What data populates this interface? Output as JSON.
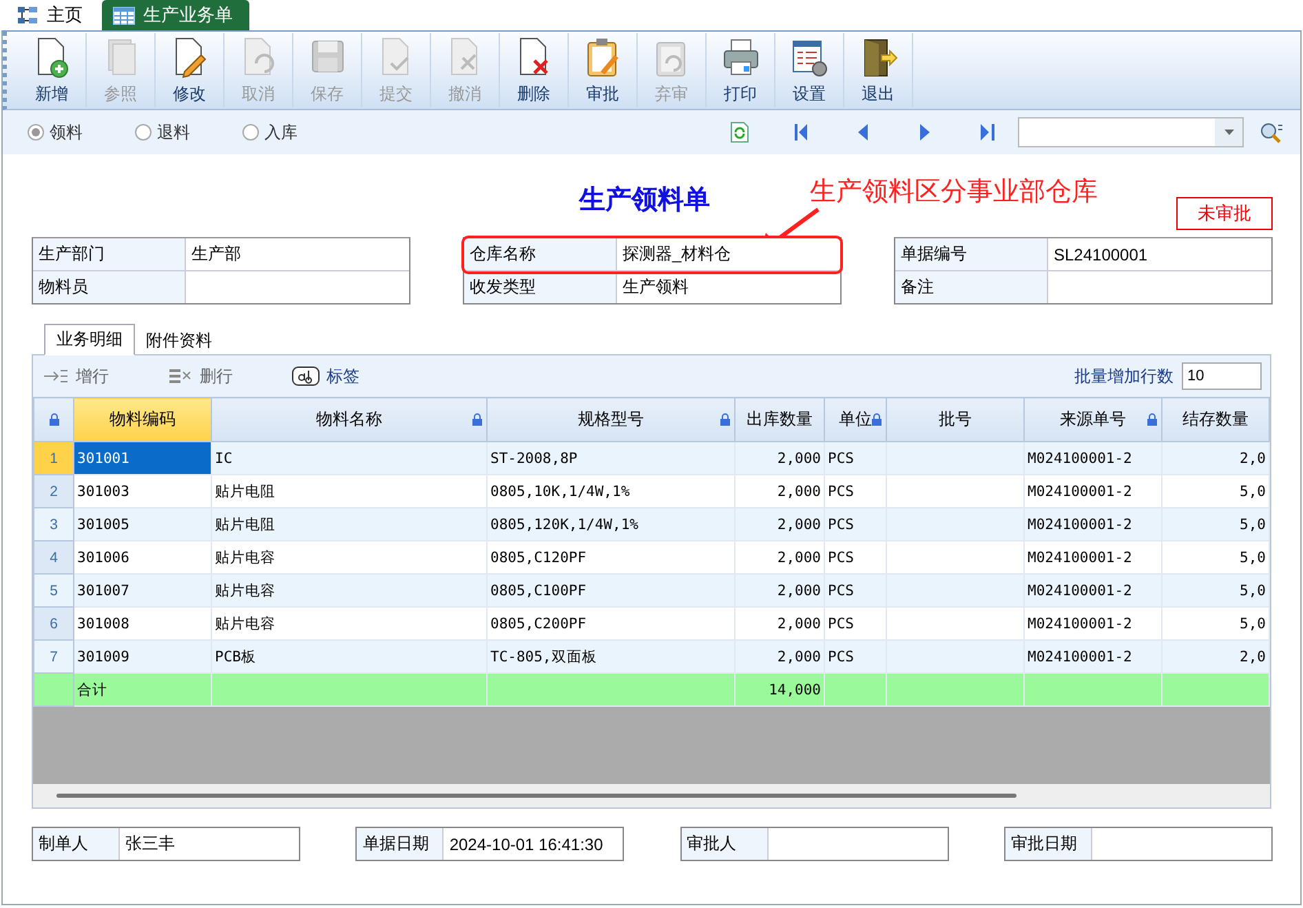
{
  "top_tabs": [
    {
      "label": "主页",
      "selected": false
    },
    {
      "label": "生产业务单",
      "selected": true
    }
  ],
  "toolbar": [
    {
      "label": "新增",
      "disabled": false
    },
    {
      "label": "参照",
      "disabled": true
    },
    {
      "label": "修改",
      "disabled": false
    },
    {
      "label": "取消",
      "disabled": true
    },
    {
      "label": "保存",
      "disabled": true
    },
    {
      "label": "提交",
      "disabled": true
    },
    {
      "label": "撤消",
      "disabled": true
    },
    {
      "label": "删除",
      "disabled": false
    },
    {
      "label": "审批",
      "disabled": false
    },
    {
      "label": "弃审",
      "disabled": true
    },
    {
      "label": "打印",
      "disabled": false
    },
    {
      "label": "设置",
      "disabled": false
    },
    {
      "label": "退出",
      "disabled": false
    }
  ],
  "mode_radios": [
    {
      "label": "领料",
      "selected": true
    },
    {
      "label": "退料",
      "selected": false
    },
    {
      "label": "入库",
      "selected": false
    }
  ],
  "title": "生产领料单",
  "annotation": "生产领料区分事业部仓库",
  "status_stamp": "未审批",
  "header_groups": [
    [
      {
        "label": "生产部门",
        "value": "生产部",
        "highlighted": false
      },
      {
        "label": "物料员",
        "highlighted": false
      }
    ],
    [
      {
        "label": "仓库名称",
        "value": "探测器_材料仓",
        "highlighted": true
      },
      {
        "label": "收发类型",
        "value": "生产领料",
        "highlighted": false
      }
    ],
    [
      {
        "label": "单据编号",
        "value": "SL24100001",
        "highlighted": false
      },
      {
        "label": "备注",
        "highlighted": false
      }
    ]
  ],
  "detail_tabs": [
    {
      "label": "业务明细",
      "selected": true
    },
    {
      "label": "附件资料",
      "selected": false
    }
  ],
  "grid_actions": [
    {
      "label": "增行",
      "disabled": true
    },
    {
      "label": "删行",
      "disabled": true
    },
    {
      "label": "标签",
      "disabled": false
    }
  ],
  "batch_label": "批量增加行数",
  "batch_value": "10",
  "table": {
    "columns": [
      {
        "label": "物料编码",
        "locked": false,
        "selected": true
      },
      {
        "label": "物料名称",
        "locked": true,
        "selected": false
      },
      {
        "label": "规格型号",
        "locked": true,
        "selected": false
      },
      {
        "label": "出库数量",
        "locked": false,
        "selected": false
      },
      {
        "label": "单位",
        "locked": true,
        "selected": false
      },
      {
        "label": "批号",
        "locked": false,
        "selected": false
      },
      {
        "label": "来源单号",
        "locked": true,
        "selected": false
      },
      {
        "label": "结存数量",
        "locked": false,
        "selected": false
      }
    ],
    "rows": [
      {
        "index": "1",
        "selected": true,
        "cells": [
          "301001",
          "IC",
          "ST-2008,8P",
          "2,000",
          "PCS",
          "",
          "M024100001-2",
          "2,0"
        ]
      },
      {
        "index": "2",
        "selected": false,
        "cells": [
          "301003",
          "贴片电阻",
          "0805,10K,1/4W,1%",
          "2,000",
          "PCS",
          "",
          "M024100001-2",
          "5,0"
        ]
      },
      {
        "index": "3",
        "selected": false,
        "cells": [
          "301005",
          "贴片电阻",
          "0805,120K,1/4W,1%",
          "2,000",
          "PCS",
          "",
          "M024100001-2",
          "5,0"
        ]
      },
      {
        "index": "4",
        "selected": false,
        "cells": [
          "301006",
          "贴片电容",
          "0805,C120PF",
          "2,000",
          "PCS",
          "",
          "M024100001-2",
          "5,0"
        ]
      },
      {
        "index": "5",
        "selected": false,
        "cells": [
          "301007",
          "贴片电容",
          "0805,C100PF",
          "2,000",
          "PCS",
          "",
          "M024100001-2",
          "5,0"
        ]
      },
      {
        "index": "6",
        "selected": false,
        "cells": [
          "301008",
          "贴片电容",
          "0805,C200PF",
          "2,000",
          "PCS",
          "",
          "M024100001-2",
          "5,0"
        ]
      },
      {
        "index": "7",
        "selected": false,
        "cells": [
          "301009",
          "PCB板",
          "TC-805,双面板",
          "2,000",
          "PCS",
          "",
          "M024100001-2",
          "2,0"
        ]
      }
    ],
    "total": {
      "label": "合计",
      "quantity": "14,000"
    }
  },
  "footer_fields": [
    {
      "label": "制单人",
      "value": "张三丰"
    },
    {
      "label": "单据日期",
      "value": "2024-10-01 16:41:30"
    },
    {
      "label": "审批人"
    },
    {
      "label": "审批日期"
    }
  ]
}
